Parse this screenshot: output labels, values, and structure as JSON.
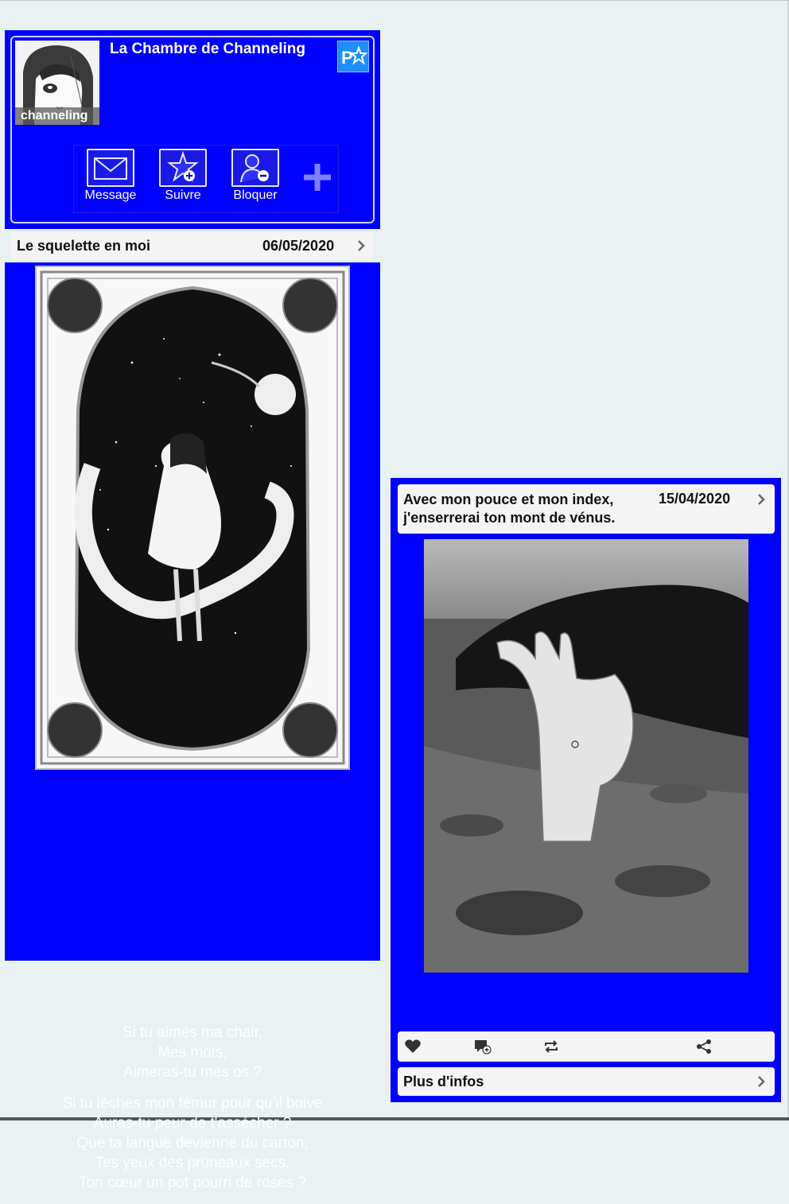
{
  "profile": {
    "title": "La Chambre de Channeling",
    "username": "channeling",
    "actions": [
      {
        "label": "Message",
        "icon": "mail-icon"
      },
      {
        "label": "Suivre",
        "icon": "star-plus-icon"
      },
      {
        "label": "Bloquer",
        "icon": "user-minus-icon"
      }
    ],
    "more_icon": "plus-icon",
    "badge_icon": "pstar-icon"
  },
  "left_post": {
    "title": "Le squelette en moi",
    "date": "06/05/2020",
    "poem_stanzas": [
      [
        "Si tu aimes ma chair,",
        "Mes mots,",
        "Aimeras-tu mes os ?"
      ],
      [
        "Si tu lèches mon fémur pour qu'il boive",
        "Auras-tu peur de t'assécher ?",
        "Que ta langue devienne du carton,",
        "Tes yeux des pruneaux secs,",
        "Ton cœur un pot pourri de roses ?"
      ]
    ]
  },
  "right_post": {
    "title_line1": "Avec mon pouce et mon index,",
    "title_line2": "j'enserrerai ton mont de vénus.",
    "date": "15/04/2020",
    "toolbar": [
      "heart-icon",
      "comment-add-icon",
      "repost-icon",
      "share-icon"
    ],
    "more_label": "Plus d'infos"
  },
  "colors": {
    "accent": "#0000ff",
    "background": "#e9f1f2",
    "header_bg": "#f4f4f4"
  }
}
